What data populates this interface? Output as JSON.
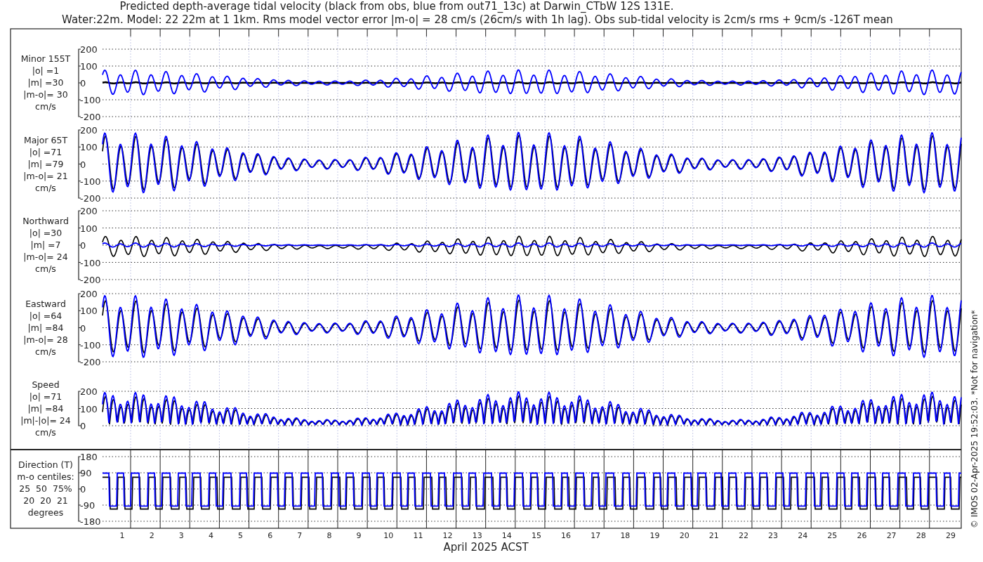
{
  "title": [
    "Predicted depth-average tidal velocity (black from obs, blue from out71_13c) at Darwin_CTbW 12S 131E.",
    "Water:22m. Model: 22 22m at 1 1km. Rms model vector error |m-o| = 28 cm/s (26cm/s with 1h lag). Obs sub-tidal velocity is 2cm/s rms + 9cm/s -126T mean"
  ],
  "panels": [
    {
      "kind": "velocity",
      "label": [
        "Minor 155T",
        "|o| =1",
        "|m| =30",
        "|m-o|= 30",
        "cm/s"
      ],
      "yticks": [
        "200",
        "100",
        "0",
        "-100",
        "-200"
      ]
    },
    {
      "kind": "velocity",
      "label": [
        "Major 65T",
        "|o| =71",
        "|m| =79",
        "|m-o|= 21",
        "cm/s"
      ],
      "yticks": [
        "200",
        "100",
        "0",
        "-100",
        "-200"
      ]
    },
    {
      "kind": "velocity",
      "label": [
        "Northward",
        "|o| =30",
        "|m| =7",
        "|m-o|= 24",
        "cm/s"
      ],
      "yticks": [
        "200",
        "100",
        "0",
        "-100",
        "-200"
      ]
    },
    {
      "kind": "velocity",
      "label": [
        "Eastward",
        "|o| =64",
        "|m| =84",
        "|m-o|= 28",
        "cm/s"
      ],
      "yticks": [
        "200",
        "100",
        "0",
        "-100",
        "-200"
      ]
    },
    {
      "kind": "speed",
      "label": [
        "Speed",
        "|o| =71",
        "|m| =84",
        "|m|-|o|= 24",
        "cm/s"
      ],
      "yticks": [
        "200",
        "100",
        "0"
      ]
    },
    {
      "kind": "direction",
      "label": [
        "Direction (T)",
        "m-o centiles:",
        "25  50  75%",
        "20  20  21",
        "degrees"
      ],
      "yticks": [
        "180",
        "90",
        "0",
        "-90",
        "-180"
      ]
    }
  ],
  "xticks": [
    "1",
    "2",
    "3",
    "4",
    "5",
    "6",
    "7",
    "8",
    "9",
    "10",
    "11",
    "12",
    "13",
    "14",
    "15",
    "16",
    "17",
    "18",
    "19",
    "20",
    "21",
    "22",
    "23",
    "24",
    "25",
    "26",
    "27",
    "28",
    "29"
  ],
  "xlabel": "April 2025 ACST",
  "credit": "© IMOS 02-Apr-2025 19:52:03. *Not for navigation*"
}
